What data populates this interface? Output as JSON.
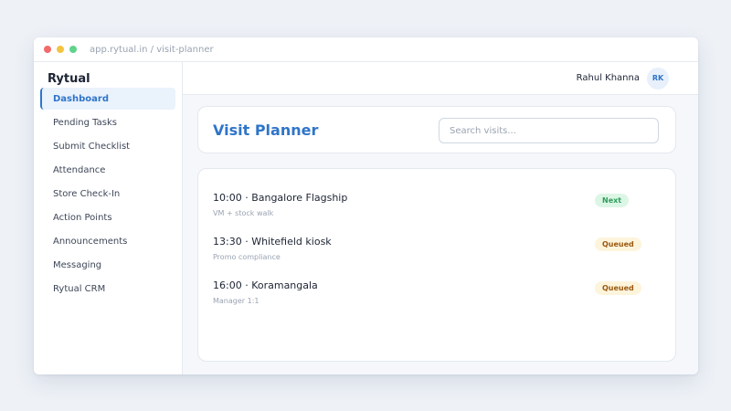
{
  "window": {
    "url": "app.rytual.in / visit-planner"
  },
  "sidebar": {
    "brand": "Rytual",
    "items": [
      {
        "label": "Dashboard",
        "active": true
      },
      {
        "label": "Pending Tasks"
      },
      {
        "label": "Submit Checklist"
      },
      {
        "label": "Attendance"
      },
      {
        "label": "Store Check-In"
      },
      {
        "label": "Action Points"
      },
      {
        "label": "Announcements"
      },
      {
        "label": "Messaging"
      },
      {
        "label": "Rytual CRM"
      }
    ]
  },
  "topbar": {
    "user_name": "Rahul Khanna",
    "avatar_initials": "RK"
  },
  "main": {
    "title": "Visit Planner",
    "search_placeholder": "Search visits...",
    "visits": [
      {
        "title": "10:00 · Bangalore Flagship",
        "subtitle": "VM + stock walk",
        "status": "Next"
      },
      {
        "title": "13:30 · Whitefield kiosk",
        "subtitle": "Promo compliance",
        "status": "Queued"
      },
      {
        "title": "16:00 · Koramangala",
        "subtitle": "Manager 1:1",
        "status": "Queued"
      }
    ]
  },
  "colors": {
    "accent": "#2f75c9",
    "status_next_bg": "#dcf6e6",
    "status_next_text": "#2e9e5b",
    "status_queued_bg": "#fdf4dc",
    "status_queued_text": "#9a5a10"
  }
}
